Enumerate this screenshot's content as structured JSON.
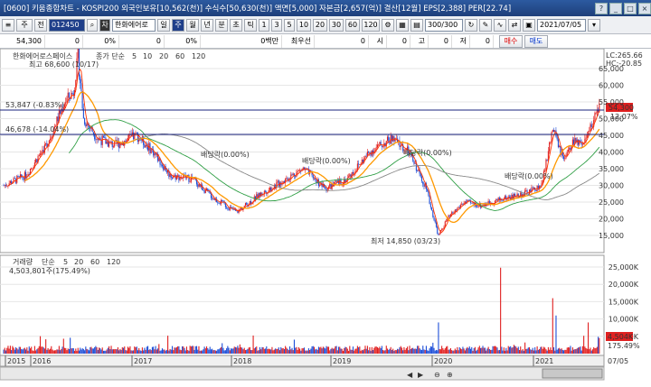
{
  "window": {
    "title": "[0600] 키움종합차트 - KOSPI200 외국인보유[10,562(천)] 수식수[50,630(천)] 액면[5,000] 자본금[2,657(억)] 결산[12월] EPS[2,388] PER[22.74]"
  },
  "toolbar": {
    "code_input": "012450",
    "stock_name": "한화에어로",
    "prefix_label": "주",
    "jeon_label": "전",
    "cha_label": "차",
    "periods": [
      "일",
      "주",
      "월",
      "년",
      "분",
      "초",
      "틱"
    ],
    "selected_period": "주",
    "interval_buttons": [
      "1",
      "3",
      "5",
      "10",
      "20",
      "30",
      "60",
      "120"
    ],
    "count": "300/300",
    "date": "2021/07/05"
  },
  "quote_bar": {
    "price": "54,300",
    "change": "0",
    "change_pct": "0%",
    "volume": "0",
    "vol_pct": "0%",
    "amount": "0백만",
    "best_label": "최우선",
    "ask_label": "0",
    "si_label": "시",
    "si_val": "0",
    "go_label": "고",
    "go_val": "0",
    "jeo_label": "저",
    "jeo_val": "0",
    "buy_label": "매수",
    "sell_label": "매도"
  },
  "price_panel": {
    "legend_name": "한화에어로스페이스",
    "legend_type": "종가 단순",
    "ma_labels": [
      "5",
      "10",
      "20",
      "60",
      "120"
    ],
    "ma_colors": [
      "#ff3300",
      "#1e88e5",
      "#ff9900",
      "#2e9e44",
      "#888888"
    ],
    "high_label": "최고 68,600 (10/17)",
    "low_label": "최저 14,850 (03/23)",
    "hline1_label": "53,847 (-0.83%)",
    "hline2_label": "46,678 (-14.04%)",
    "dividend_labels": [
      "배당락(0.00%)",
      "배당락(0.00%)",
      "배당락(0.00%)",
      "배당락(0.00%)"
    ],
    "lc_label": "LC:265.66",
    "hc_label": "HC:-20.85",
    "last_price": "54,300",
    "last_pct": "12.07%",
    "y_ticks": [
      "65,000",
      "60,000",
      "55,000",
      "50,000",
      "45,000",
      "40,000",
      "35,000",
      "30,000",
      "25,000",
      "20,000",
      "15,000"
    ]
  },
  "volume_panel": {
    "legend_name": "거래량",
    "legend_type": "단순",
    "ma_labels": [
      "5",
      "20",
      "60",
      "120"
    ],
    "value_label": "4,503,801주(175.49%)",
    "y_ticks": [
      "25,000K",
      "20,000K",
      "15,000K",
      "10,000K",
      "5,000K"
    ],
    "last_vol": "4,504K",
    "last_pct": "175.49%"
  },
  "x_axis": {
    "years": [
      "2015",
      "2016",
      "2017",
      "2018",
      "2019",
      "2020",
      "2021"
    ],
    "right_label": "07/05"
  },
  "colors": {
    "up": "#e02020",
    "down": "#1e4fd8",
    "bg": "#ffffff",
    "grid": "#e6e6e6"
  }
}
